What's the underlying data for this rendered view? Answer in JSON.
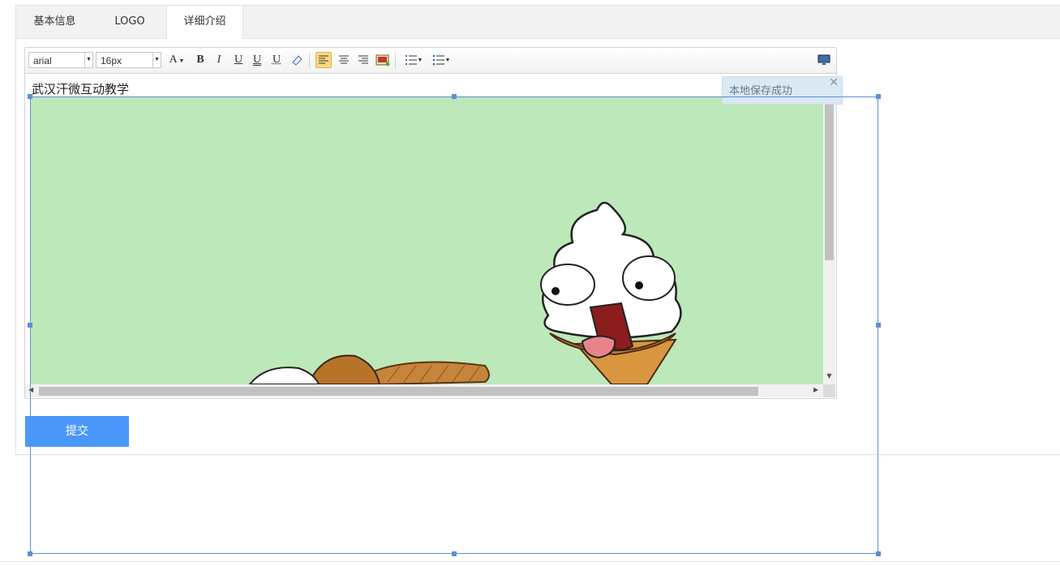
{
  "tabs": [
    {
      "label": "基本信息",
      "active": false
    },
    {
      "label": "LOGO",
      "active": false
    },
    {
      "label": "详细介绍",
      "active": true
    }
  ],
  "toolbar": {
    "font_family": "arial",
    "font_size": "16px",
    "buttons": {
      "font_color": "A",
      "bold": "B",
      "italic": "I",
      "underline": "U",
      "underline2": "U",
      "underline3": "U"
    }
  },
  "editor": {
    "content_text": "武汉汗微互动教学"
  },
  "toast": {
    "message": "本地保存成功",
    "close": "✕"
  },
  "submit_label": "提交",
  "colors": {
    "accent": "#4a98fb",
    "image_bg": "#bde8b9",
    "selection": "#5b8fd6",
    "toast_bg": "#d9e9f5"
  }
}
